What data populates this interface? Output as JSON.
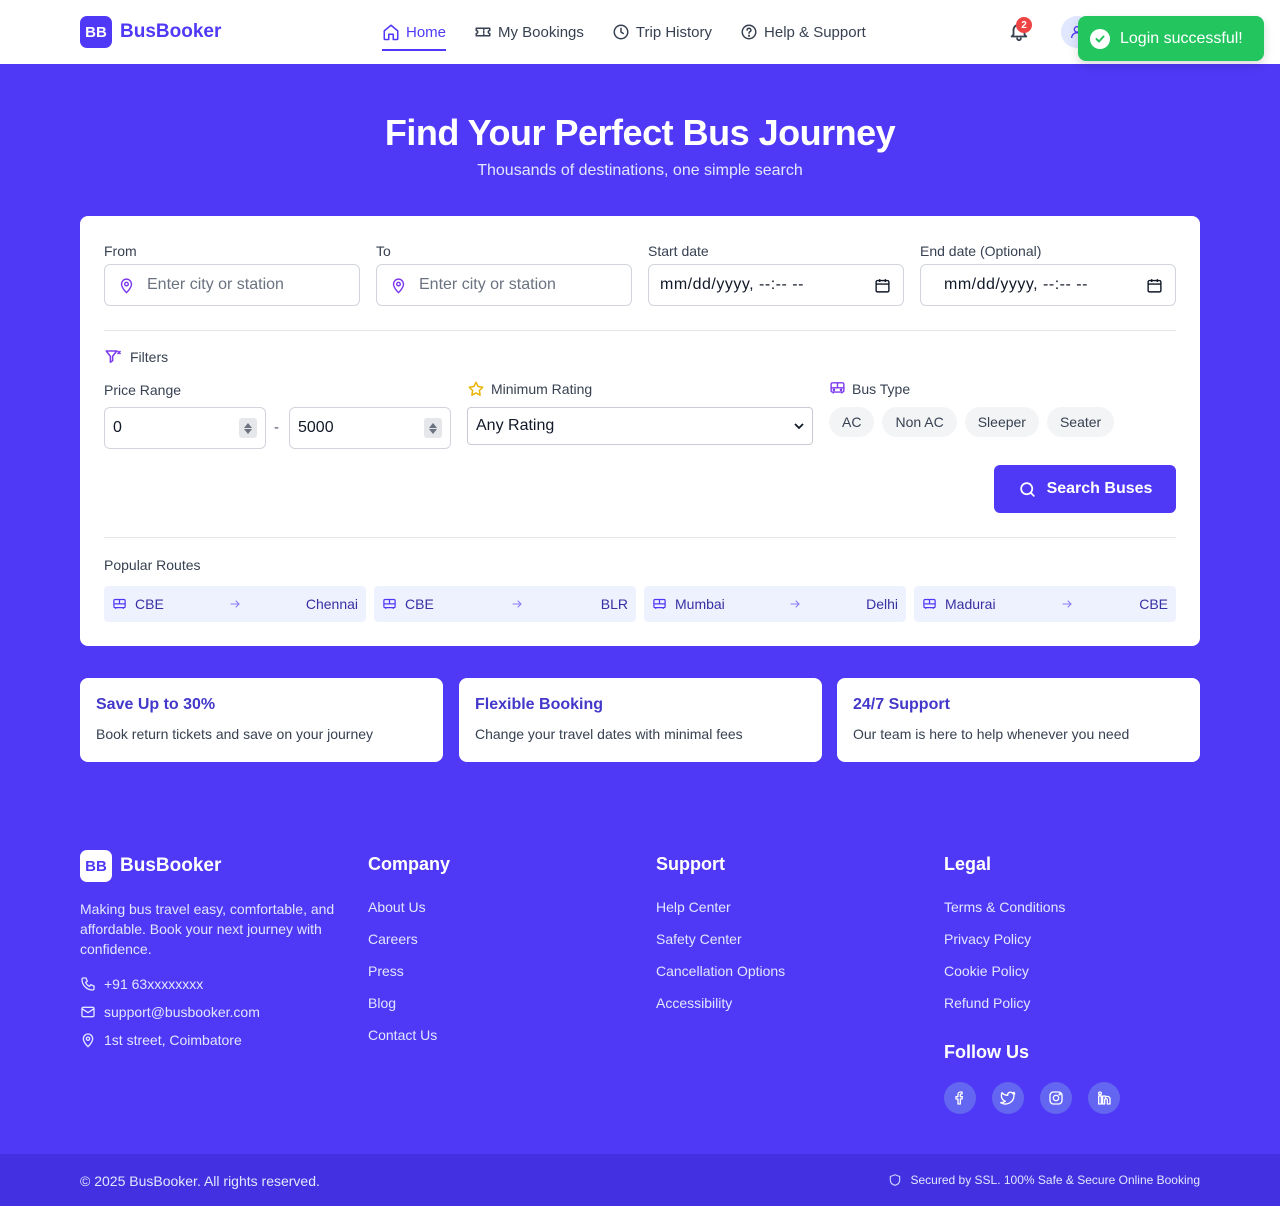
{
  "brand": {
    "logo_initials": "BB",
    "name": "BusBooker"
  },
  "nav": {
    "items": [
      {
        "label": "Home",
        "icon": "home-icon",
        "active": true
      },
      {
        "label": "My Bookings",
        "icon": "ticket-icon",
        "active": false
      },
      {
        "label": "Trip History",
        "icon": "clock-icon",
        "active": false
      },
      {
        "label": "Help & Support",
        "icon": "help-circle-icon",
        "active": false
      }
    ],
    "notification_count": "2"
  },
  "toast": {
    "message": "Login successful!",
    "color": "#22c55e"
  },
  "hero": {
    "title": "Find Your Perfect Bus Journey",
    "subtitle": "Thousands of destinations, one simple search"
  },
  "search": {
    "from": {
      "label": "From",
      "placeholder": "Enter city or station"
    },
    "to": {
      "label": "To",
      "placeholder": "Enter city or station"
    },
    "start_date": {
      "label": "Start date",
      "value": "mm/dd/yyyy, --:-- --"
    },
    "end_date": {
      "label": "End date (Optional)",
      "value": "mm/dd/yyyy, --:-- --"
    },
    "filters_title": "Filters",
    "price_range": {
      "label": "Price Range",
      "min": "0",
      "max": "5000",
      "separator": "-"
    },
    "rating": {
      "label": "Minimum Rating",
      "selected": "Any Rating"
    },
    "bus_type": {
      "label": "Bus Type",
      "options": [
        "AC",
        "Non AC",
        "Sleeper",
        "Seater"
      ]
    },
    "button_label": "Search Buses"
  },
  "popular_routes": {
    "title": "Popular Routes",
    "routes": [
      {
        "from": "CBE",
        "to": "Chennai"
      },
      {
        "from": "CBE",
        "to": "BLR"
      },
      {
        "from": "Mumbai",
        "to": "Delhi"
      },
      {
        "from": "Madurai",
        "to": "CBE"
      }
    ]
  },
  "features": [
    {
      "title": "Save Up to 30%",
      "description": "Book return tickets and save on your journey"
    },
    {
      "title": "Flexible Booking",
      "description": "Change your travel dates with minimal fees"
    },
    {
      "title": "24/7 Support",
      "description": "Our team is here to help whenever you need"
    }
  ],
  "footer": {
    "about": "Making bus travel easy, comfortable, and affordable. Book your next journey with confidence.",
    "phone": "+91 63xxxxxxxx",
    "email": "support@busbooker.com",
    "address": "1st street, Coimbatore",
    "columns": [
      {
        "title": "Company",
        "links": [
          "About Us",
          "Careers",
          "Press",
          "Blog",
          "Contact Us"
        ]
      },
      {
        "title": "Support",
        "links": [
          "Help Center",
          "Safety Center",
          "Cancellation Options",
          "Accessibility"
        ]
      },
      {
        "title": "Legal",
        "links": [
          "Terms & Conditions",
          "Privacy Policy",
          "Cookie Policy",
          "Refund Policy"
        ]
      }
    ],
    "follow_title": "Follow Us",
    "socials": [
      "facebook-icon",
      "twitter-icon",
      "instagram-icon",
      "linkedin-icon"
    ],
    "copyright": "© 2025 BusBooker. All rights reserved.",
    "secure_text": "Secured by SSL. 100% Safe & Secure Online Booking"
  },
  "colors": {
    "brand": "#4f39f6",
    "success": "#22c55e",
    "badge": "#ef4444"
  }
}
